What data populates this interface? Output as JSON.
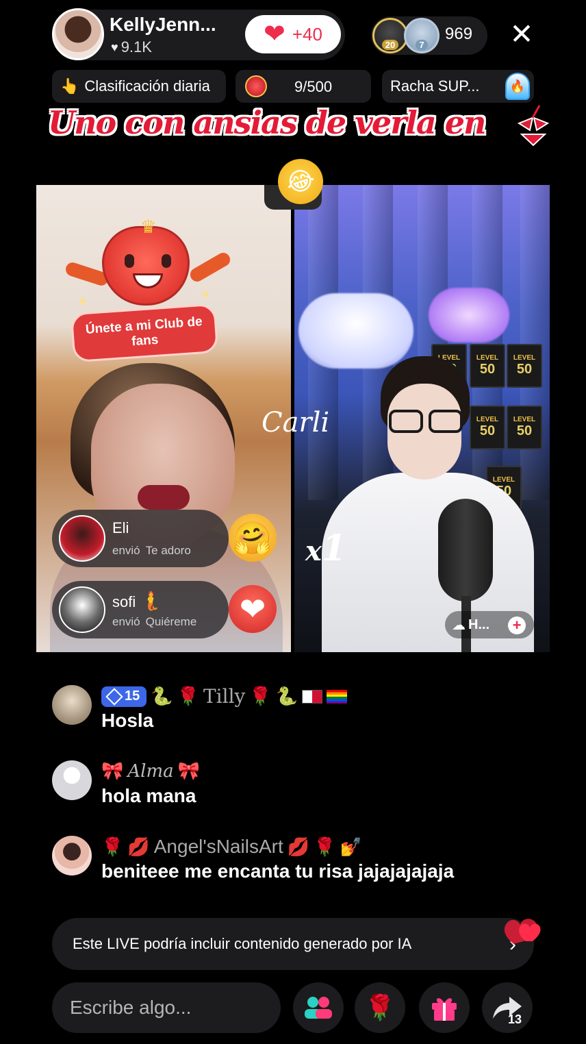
{
  "host": {
    "name": "KellyJenn...",
    "likes": "9.1K",
    "follow_bonus": "+40"
  },
  "viewers": {
    "badge_a": "20",
    "badge_b": "7",
    "count": "969"
  },
  "chips": {
    "ranking": "Clasificación diaria",
    "goal_current": "9",
    "goal_total": "/500",
    "streak": "Racha SUP..."
  },
  "banner": {
    "text": "Uno con ansias de verla en"
  },
  "stream": {
    "fanclub_label": "Únete a mi Club de fans",
    "watermark": "Carli",
    "multiplier_x": "x",
    "multiplier_n": "1",
    "host_tag": "H..."
  },
  "gifts": [
    {
      "sender": "Eli",
      "verb": "envió",
      "gift": "Te adoro"
    },
    {
      "sender": "sofi",
      "verb": "envió",
      "gift": "Quiéreme"
    }
  ],
  "chat": [
    {
      "level": "15",
      "name": "Tilly",
      "message": "Hosla"
    },
    {
      "name": "Alma",
      "message": "hola mana"
    },
    {
      "name": "Angel'sNailsArt",
      "message": "beniteee me encanta tu risa jajajajajaja"
    }
  ],
  "notice": {
    "text": "Este LIVE podría incluir contenido generado por IA"
  },
  "bottom": {
    "comment_placeholder": "Escribe algo...",
    "share_count": "13"
  },
  "colors": {
    "accent": "#ee2d4d",
    "banner": "#e31b37",
    "level_badge": "#3c67e8"
  }
}
